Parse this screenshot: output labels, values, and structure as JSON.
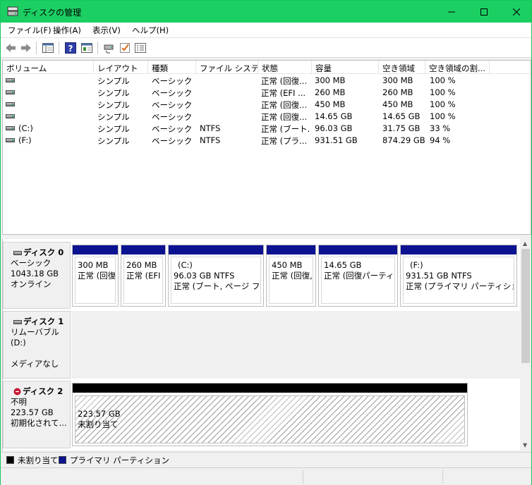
{
  "window": {
    "title": "ディスクの管理",
    "accent": "#1bcf63"
  },
  "menu": [
    "ファイル(F)",
    "操作(A)",
    "表示(V)",
    "ヘルプ(H)"
  ],
  "toolbar": [
    "back-arrow-icon",
    "forward-arrow-icon",
    "console-tree-icon",
    "help-icon",
    "properties-icon",
    "connect-icon",
    "check-icon",
    "settings-list-icon"
  ],
  "columns": [
    "ボリューム",
    "レイアウト",
    "種類",
    "ファイル システム",
    "状態",
    "容量",
    "空き領域",
    "空き領域の割..."
  ],
  "volumes": [
    {
      "name": "",
      "layout": "シンプル",
      "type": "ベーシック",
      "fs": "",
      "status": "正常 (回復...",
      "capacity": "300 MB",
      "free": "300 MB",
      "pct": "100 %"
    },
    {
      "name": "",
      "layout": "シンプル",
      "type": "ベーシック",
      "fs": "",
      "status": "正常 (EFI ...",
      "capacity": "260 MB",
      "free": "260 MB",
      "pct": "100 %"
    },
    {
      "name": "",
      "layout": "シンプル",
      "type": "ベーシック",
      "fs": "",
      "status": "正常 (回復...",
      "capacity": "450 MB",
      "free": "450 MB",
      "pct": "100 %"
    },
    {
      "name": "",
      "layout": "シンプル",
      "type": "ベーシック",
      "fs": "",
      "status": "正常 (回復...",
      "capacity": "14.65 GB",
      "free": "14.65 GB",
      "pct": "100 %"
    },
    {
      "name": "(C:)",
      "layout": "シンプル",
      "type": "ベーシック",
      "fs": "NTFS",
      "status": "正常 (ブート...",
      "capacity": "96.03 GB",
      "free": "31.75 GB",
      "pct": "33 %"
    },
    {
      "name": "(F:)",
      "layout": "シンプル",
      "type": "ベーシック",
      "fs": "NTFS",
      "status": "正常 (プラ...",
      "capacity": "931.51 GB",
      "free": "874.29 GB",
      "pct": "94 %"
    }
  ],
  "disks": [
    {
      "name": "ディスク 0",
      "kind": "ベーシック",
      "size": "1043.18 GB",
      "state": "オンライン",
      "partitions": [
        {
          "label": "",
          "size": "300 MB",
          "status": "正常 (回復"
        },
        {
          "label": "",
          "size": "260 MB",
          "status": "正常 (EFI ·"
        },
        {
          "label": "(C:)",
          "size": "96.03 GB NTFS",
          "status": "正常 (ブート, ページ ファイル"
        },
        {
          "label": "",
          "size": "450 MB",
          "status": "正常 (回復,"
        },
        {
          "label": "",
          "size": "14.65 GB",
          "status": "正常 (回復パーティシ"
        },
        {
          "label": "(F:)",
          "size": "931.51 GB NTFS",
          "status": "正常 (プライマリ パーティション)"
        }
      ]
    },
    {
      "name": "ディスク 1",
      "kind": "リムーバブル (D:)",
      "state": "メディアなし"
    },
    {
      "name": "ディスク 2",
      "kind": "不明",
      "size": "223.57 GB",
      "state": "初期化されて...",
      "unallocated": {
        "size": "223.57 GB",
        "label": "未割り当て"
      }
    }
  ],
  "legend": [
    {
      "label": "未割り当て",
      "color": "#000000"
    },
    {
      "label": "プライマリ パーティション",
      "color": "#0b1391"
    }
  ]
}
